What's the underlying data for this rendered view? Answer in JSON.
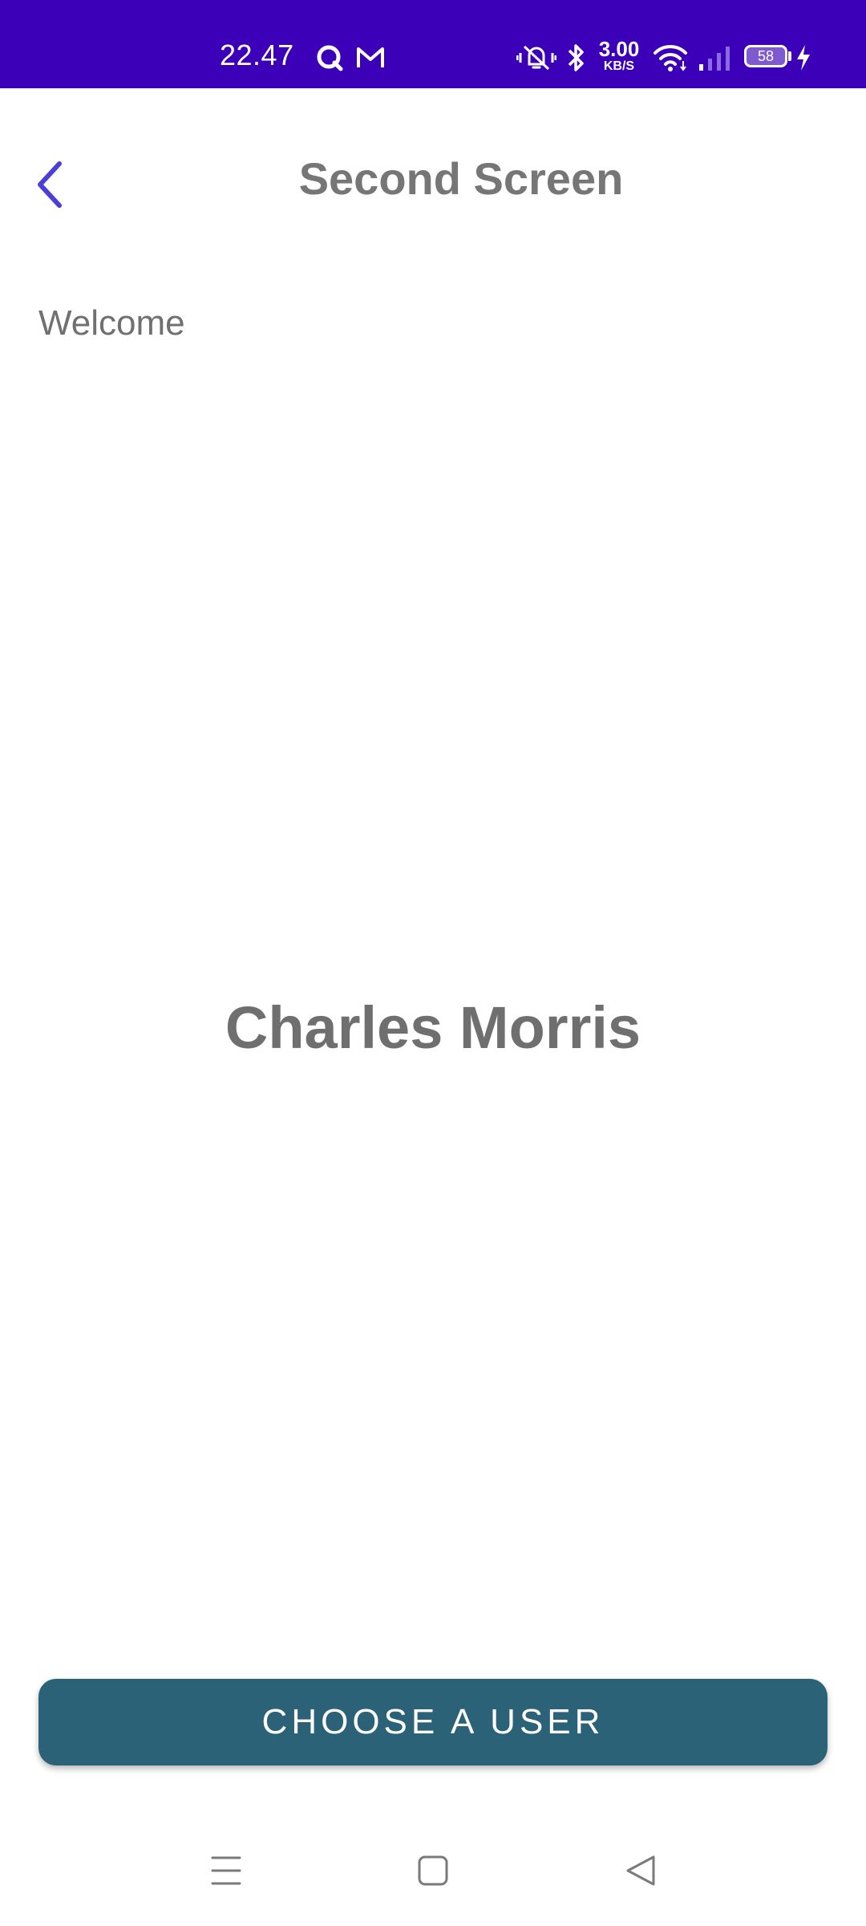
{
  "status_bar": {
    "time": "22.47",
    "net_speed_value": "3.00",
    "net_speed_unit": "KB/S",
    "battery_level": "58",
    "bg_color": "#3b00b8",
    "icons": [
      "qr-app-icon",
      "gmail-icon",
      "vibrate-icon",
      "bluetooth-icon",
      "wifi-icon",
      "signal-icon",
      "battery-icon",
      "charging-icon"
    ]
  },
  "app_bar": {
    "title": "Second Screen",
    "back_icon": "chevron-left-icon",
    "accent_color": "#4a3fd6"
  },
  "content": {
    "welcome_label": "Welcome",
    "user_name": "Charles Morris"
  },
  "actions": {
    "choose_user_label": "CHOOSE A USER",
    "button_color": "#2c6277"
  },
  "nav_bar": {
    "icons": [
      "menu-icon",
      "home-icon",
      "back-icon"
    ]
  }
}
